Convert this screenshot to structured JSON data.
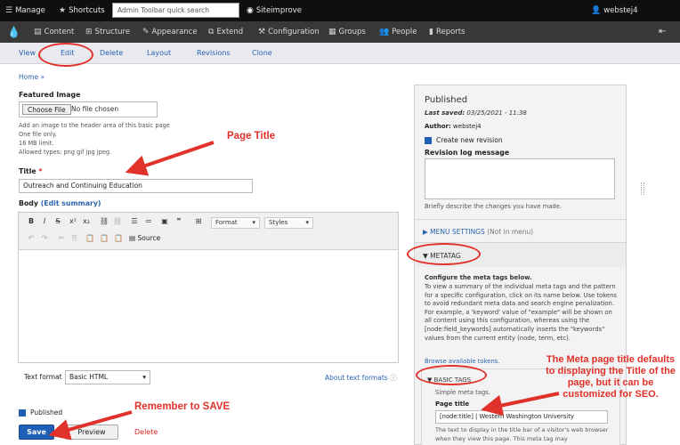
{
  "toolbar": {
    "manage": "Manage",
    "shortcuts": "Shortcuts",
    "search_placeholder": "Admin Toolbar quick search",
    "siteimprove": "Siteimprove",
    "user": "webstej4"
  },
  "admin_menu": [
    "Content",
    "Structure",
    "Appearance",
    "Extend",
    "Configuration",
    "Groups",
    "People",
    "Reports"
  ],
  "tabs": [
    "View",
    "Edit",
    "Delete",
    "Layout",
    "Revisions",
    "Clone"
  ],
  "breadcrumb": "Home »",
  "featured_image": {
    "label": "Featured Image",
    "choose_file": "Choose File",
    "no_file": "No file chosen",
    "help": [
      "Add an image to the header area of this basic page",
      "One file only.",
      "16 MB limit.",
      "Allowed types: png gif jpg jpeg."
    ]
  },
  "title_field": {
    "label": "Title",
    "required": "*",
    "value": "Outreach and Continuing Education"
  },
  "body_field": {
    "label": "Body",
    "edit_summary": "(Edit summary)",
    "format_dropdown": "Format",
    "styles_dropdown": "Styles",
    "source_button": "Source",
    "text_format_label": "Text format",
    "text_format_value": "Basic HTML",
    "about_formats": "About text formats"
  },
  "published_checkbox": "Published",
  "actions": {
    "save": "Save",
    "preview": "Preview",
    "delete": "Delete"
  },
  "sidebar": {
    "status": "Published",
    "last_saved_label": "Last saved:",
    "last_saved_value": "03/25/2021 - 11:38",
    "author_label": "Author:",
    "author_value": "webstej4",
    "create_revision": "Create new revision",
    "revision_log_label": "Revision log message",
    "revision_help": "Briefly describe the changes you have made.",
    "menu_settings": "MENU SETTINGS",
    "menu_settings_note": "(Not in menu)",
    "metatag": "METATAG",
    "metatag_configure": "Configure the meta tags below.",
    "metatag_desc": "To view a summary of the individual meta tags and the pattern for a specific configuration, click on its name below. Use tokens to avoid redundant meta data and search engine penalization. For example, a 'keyword' value of \"example\" will be shown on all content using this configuration, whereas using the [node:field_keywords] automatically inserts the \"keywords\" values from the current entity (node, term, etc).",
    "browse_tokens": "Browse available tokens.",
    "basic_tags": "BASIC TAGS",
    "simple_meta": "Simple meta tags.",
    "page_title_label": "Page title",
    "page_title_value": "[node:title] | Western Washington University",
    "page_title_help": "The text to display in the title bar of a visitor's web browser when they view this page. This meta tag may"
  },
  "annotations": {
    "page_title": "Page Title",
    "remember_save": "Remember to SAVE",
    "meta_note": "The Meta page title defaults to displaying the Title of the page, but it can be customized for SEO."
  },
  "colors": {
    "accent_red": "#e0322a",
    "link_blue": "#2a64b0",
    "save_blue": "#1f5fb5"
  }
}
